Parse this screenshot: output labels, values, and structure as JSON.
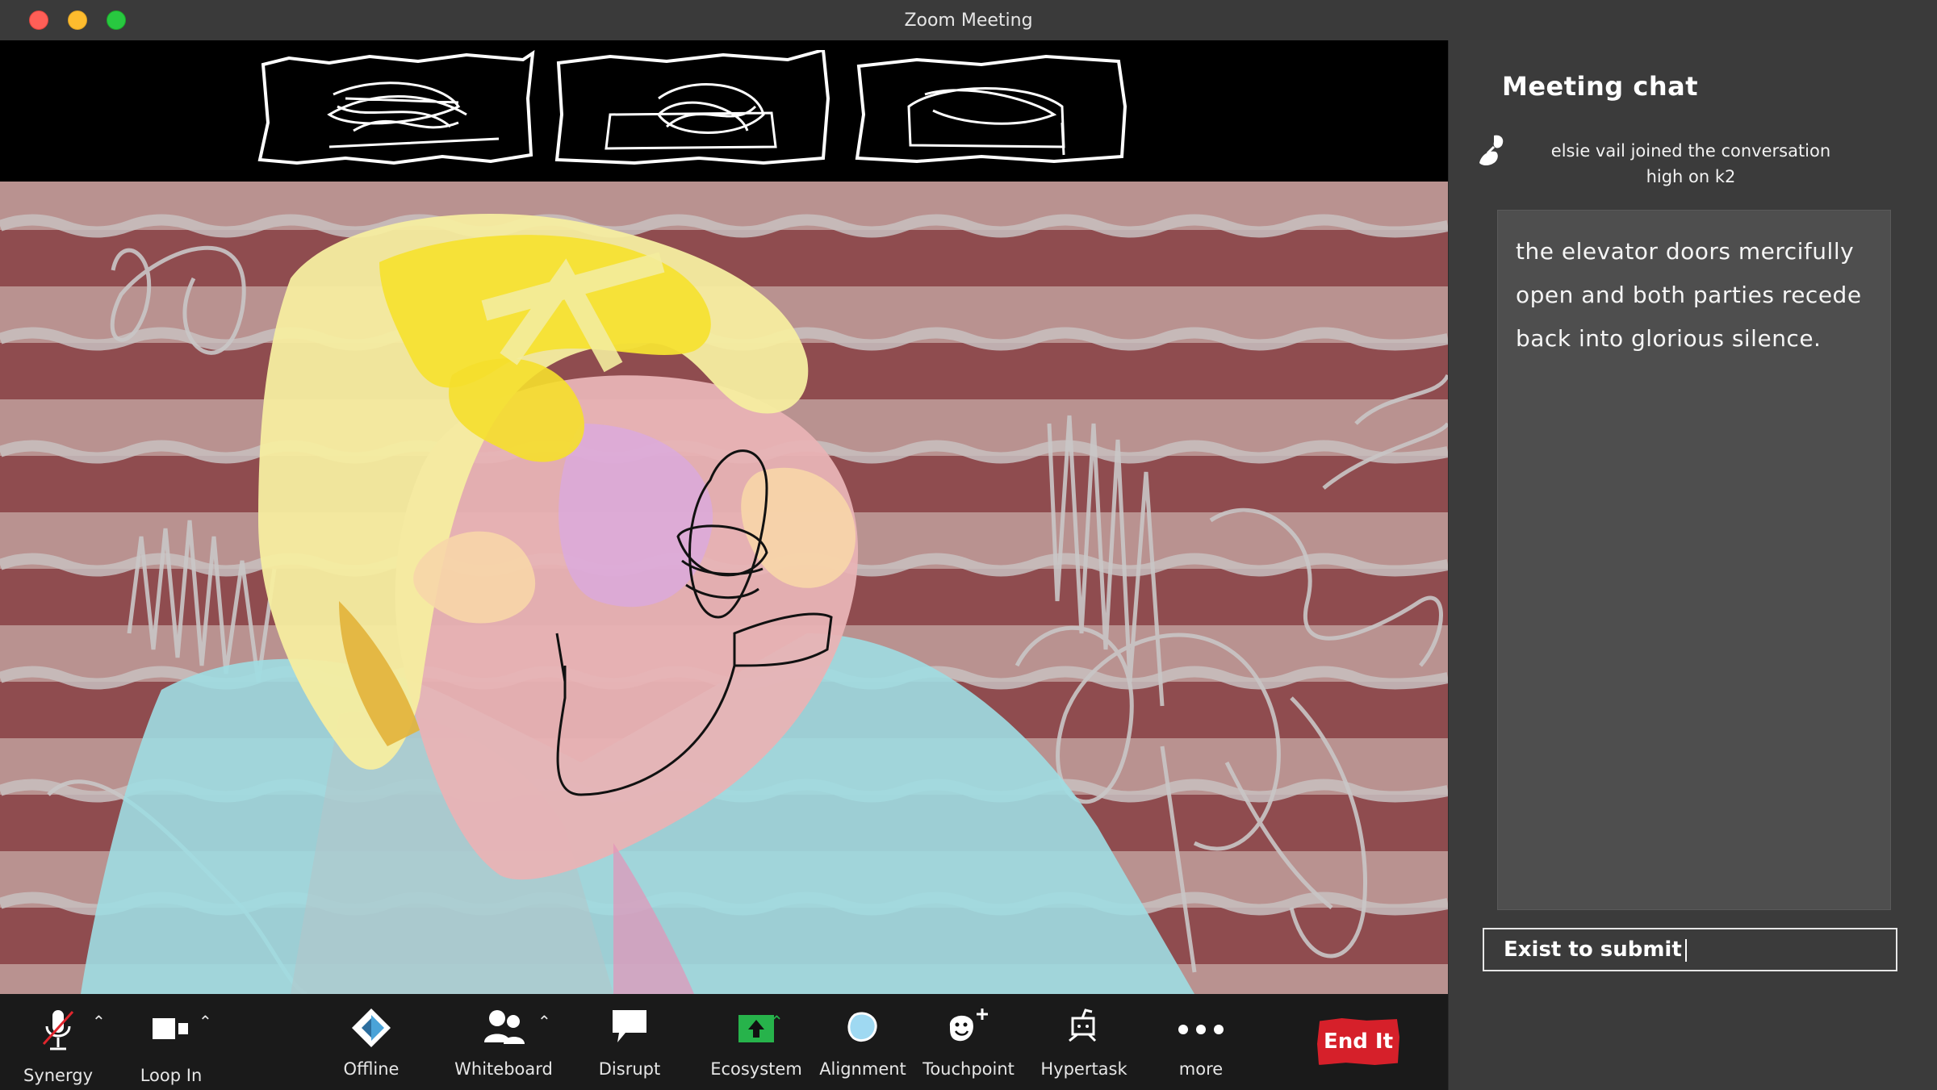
{
  "window": {
    "title": "Zoom Meeting"
  },
  "chat": {
    "title": "Meeting chat",
    "join_notice_line1": "elsie vail  joined the conversation",
    "join_notice_line2": "high on k2",
    "message": "the elevator doors mercifully open and both parties recede back into glorious silence.",
    "input_value": "Exist to submit"
  },
  "toolbar": {
    "items": [
      {
        "label": "Synergy",
        "icon": "microphone-muted-icon"
      },
      {
        "label": "Loop In",
        "icon": "video-camera-icon"
      },
      {
        "label": "Offline",
        "icon": "diamond-shield-icon"
      },
      {
        "label": "Whiteboard",
        "icon": "participants-icon"
      },
      {
        "label": "Disrupt",
        "icon": "speech-bubble-icon"
      },
      {
        "label": "Ecosystem",
        "icon": "share-screen-icon"
      },
      {
        "label": "Alignment",
        "icon": "blue-blob-icon"
      },
      {
        "label": "Touchpoint",
        "icon": "smiley-plus-icon"
      },
      {
        "label": "Hypertask",
        "icon": "robot-icon"
      },
      {
        "label": "more",
        "icon": "more-dots-icon"
      }
    ],
    "end_label": "End It"
  },
  "colors": {
    "accent_red": "#d6202a",
    "share_green": "#27b34b",
    "panel_gray": "#3b3b3b"
  }
}
